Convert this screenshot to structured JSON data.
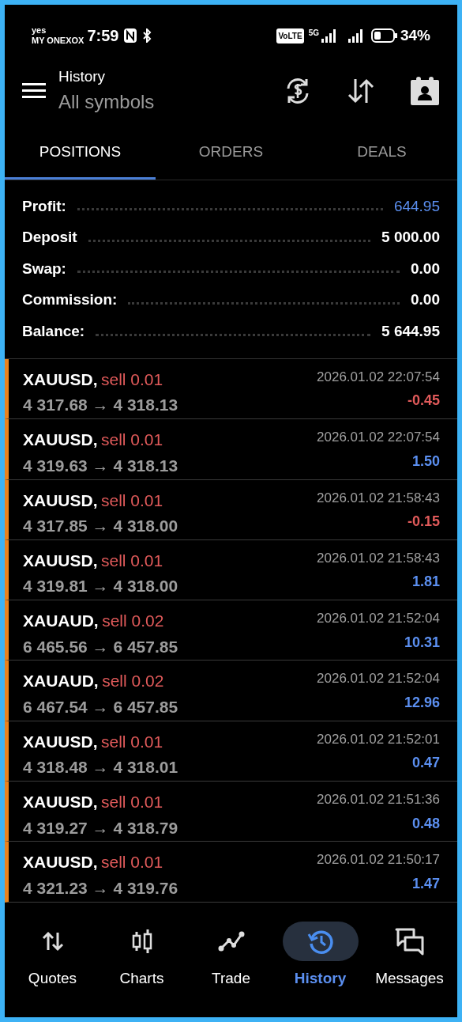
{
  "status_bar": {
    "carrier_top": "yes",
    "carrier": "MY ONEXOX",
    "time": "7:59",
    "volte": "VoLTE",
    "network": "5G",
    "battery": "34%"
  },
  "header": {
    "title": "History",
    "subtitle": "All symbols"
  },
  "tabs": [
    {
      "label": "POSITIONS",
      "selected": true
    },
    {
      "label": "ORDERS",
      "selected": false
    },
    {
      "label": "DEALS",
      "selected": false
    }
  ],
  "summary": [
    {
      "label": "Profit:",
      "value": "644.95",
      "highlight": true
    },
    {
      "label": "Deposit",
      "value": "5 000.00",
      "highlight": false
    },
    {
      "label": "Swap:",
      "value": "0.00",
      "highlight": false
    },
    {
      "label": "Commission:",
      "value": "0.00",
      "highlight": false
    },
    {
      "label": "Balance:",
      "value": "5 644.95",
      "highlight": false
    }
  ],
  "positions": [
    {
      "symbol": "XAUUSD,",
      "side": "sell 0.01",
      "prices": "4 317.68 → 4 318.13",
      "time": "2026.01.02 22:07:54",
      "profit": "-0.45",
      "loss": true
    },
    {
      "symbol": "XAUUSD,",
      "side": "sell 0.01",
      "prices": "4 319.63 → 4 318.13",
      "time": "2026.01.02 22:07:54",
      "profit": "1.50",
      "loss": false
    },
    {
      "symbol": "XAUUSD,",
      "side": "sell 0.01",
      "prices": "4 317.85 → 4 318.00",
      "time": "2026.01.02 21:58:43",
      "profit": "-0.15",
      "loss": true
    },
    {
      "symbol": "XAUUSD,",
      "side": "sell 0.01",
      "prices": "4 319.81 → 4 318.00",
      "time": "2026.01.02 21:58:43",
      "profit": "1.81",
      "loss": false
    },
    {
      "symbol": "XAUAUD,",
      "side": "sell 0.02",
      "prices": "6 465.56 → 6 457.85",
      "time": "2026.01.02 21:52:04",
      "profit": "10.31",
      "loss": false
    },
    {
      "symbol": "XAUAUD,",
      "side": "sell 0.02",
      "prices": "6 467.54 → 6 457.85",
      "time": "2026.01.02 21:52:04",
      "profit": "12.96",
      "loss": false
    },
    {
      "symbol": "XAUUSD,",
      "side": "sell 0.01",
      "prices": "4 318.48 → 4 318.01",
      "time": "2026.01.02 21:52:01",
      "profit": "0.47",
      "loss": false
    },
    {
      "symbol": "XAUUSD,",
      "side": "sell 0.01",
      "prices": "4 319.27 → 4 318.79",
      "time": "2026.01.02 21:51:36",
      "profit": "0.48",
      "loss": false
    },
    {
      "symbol": "XAUUSD,",
      "side": "sell 0.01",
      "prices": "4 321.23 → 4 319.76",
      "time": "2026.01.02 21:50:17",
      "profit": "1.47",
      "loss": false
    }
  ],
  "bottom_nav": [
    {
      "label": "Quotes",
      "selected": false
    },
    {
      "label": "Charts",
      "selected": false
    },
    {
      "label": "Trade",
      "selected": false
    },
    {
      "label": "History",
      "selected": true
    },
    {
      "label": "Messages",
      "selected": false
    }
  ]
}
